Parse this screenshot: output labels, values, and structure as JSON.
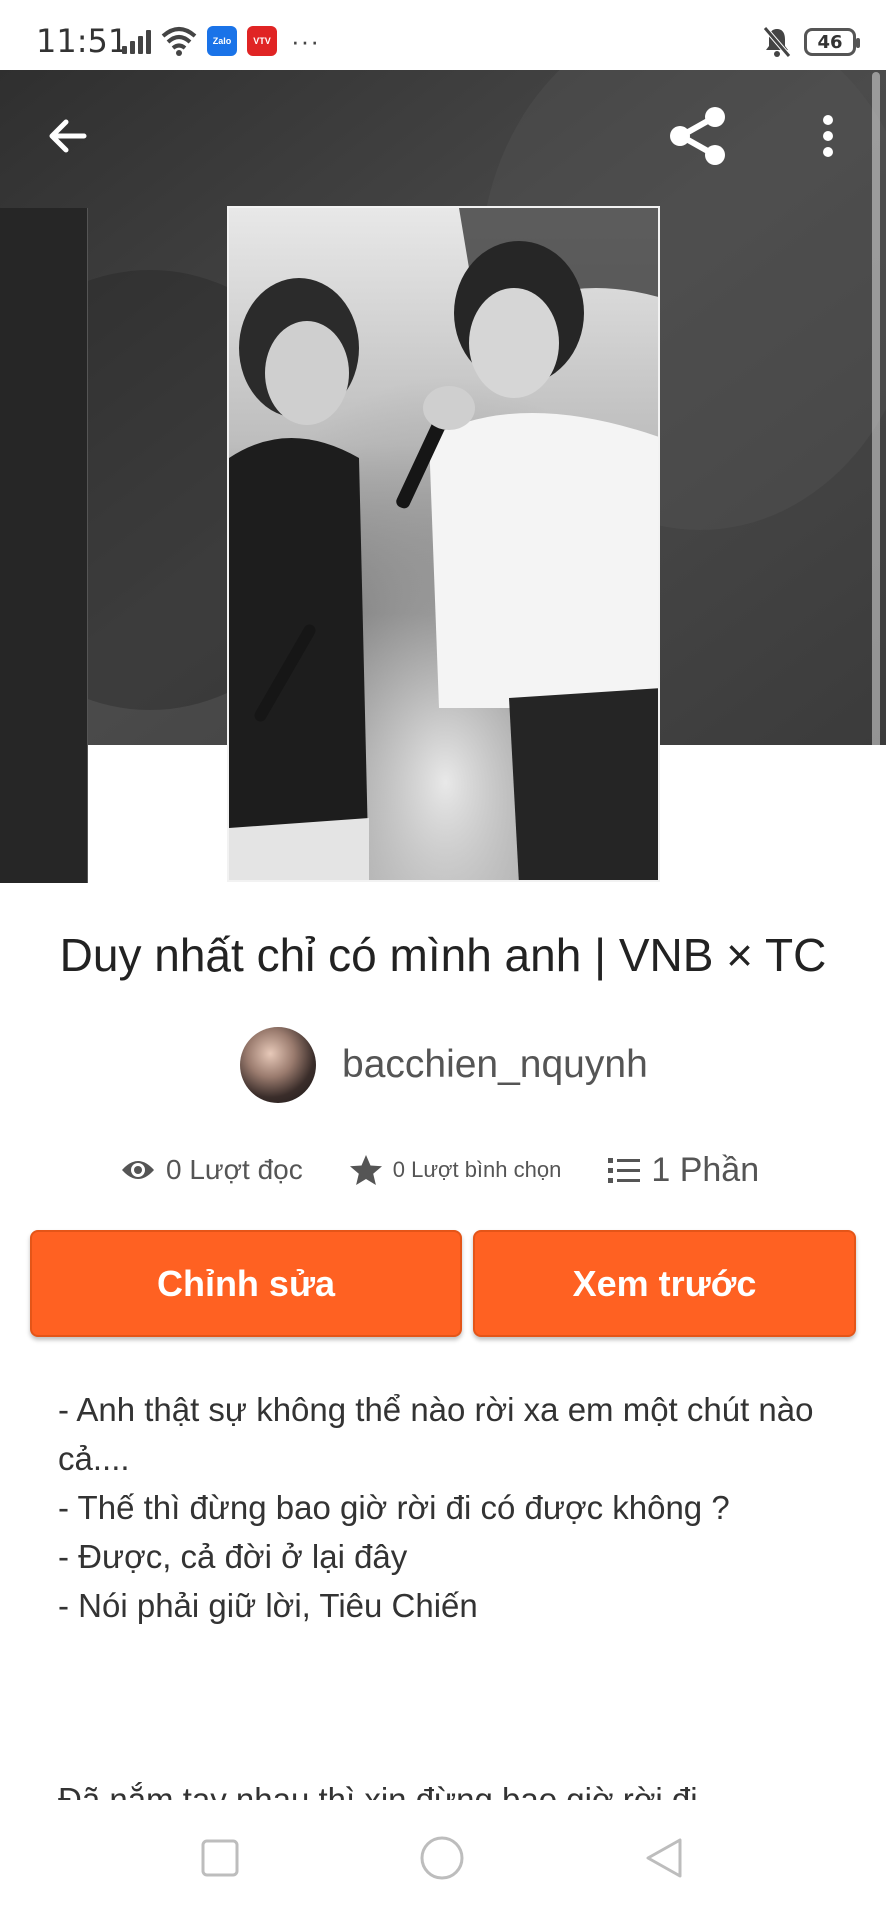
{
  "status_bar": {
    "time": "11:51",
    "zalo_label": "Zalo",
    "app2_label": "VTV",
    "more": "···",
    "battery": "46"
  },
  "toolbar": {
    "back_icon": "arrow-left-icon",
    "share_icon": "share-icon",
    "more_icon": "more-vertical-icon"
  },
  "story": {
    "title": "Duy nhất chỉ có mình anh  | VNB × TC",
    "author": "bacchien_nquynh",
    "reads": "0 Lượt đọc",
    "votes": "0 Lượt bình chọn",
    "parts": "1 Phần"
  },
  "actions": {
    "edit_label": "Chỉnh sửa",
    "preview_label": "Xem trước"
  },
  "description": {
    "lines": [
      "- Anh thật sự không thể nào rời xa em một chút nào cả....",
      "- Thế thì đừng bao giờ rời đi có được không ?",
      "- Được, cả đời ở lại đây",
      "- Nói phải giữ lời, Tiêu Chiến"
    ],
    "cut_line": "Đã nắm tay nhau thì xin đừng bao giờ rời đi"
  },
  "colors": {
    "accent": "#ff6122",
    "hero_bg": "#3c3c3c"
  }
}
